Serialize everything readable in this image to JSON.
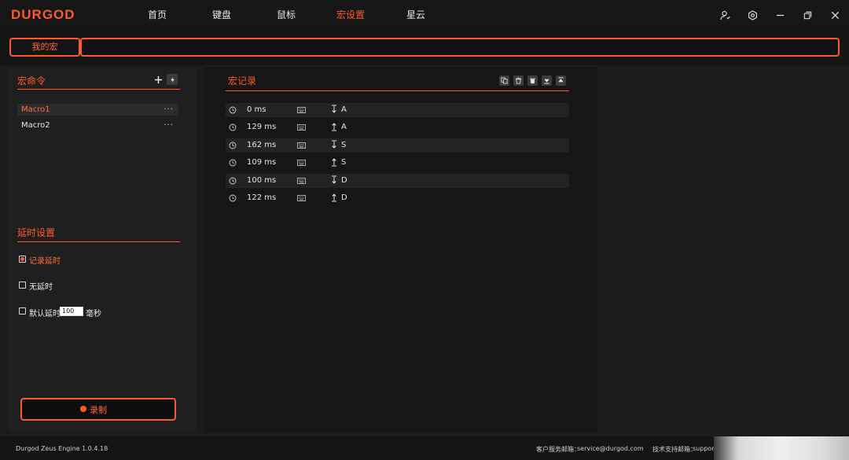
{
  "brand": {
    "logo": "DURGOD",
    "color": "#ff5a2a"
  },
  "nav": [
    {
      "label": "首页",
      "active": false
    },
    {
      "label": "键盘",
      "active": false
    },
    {
      "label": "鼠标",
      "active": false
    },
    {
      "label": "宏设置",
      "active": true
    },
    {
      "label": "星云",
      "active": false
    }
  ],
  "window_icons": [
    "user-icon",
    "settings-gear-icon",
    "minimize-icon",
    "restore-icon",
    "close-icon"
  ],
  "tabbar": {
    "tab_label": "我的宏",
    "name_value": ""
  },
  "macro_panel": {
    "title": "宏命令",
    "add_icon": "plus-icon",
    "import_icon": "bolt-icon",
    "items": [
      {
        "name": "Macro1",
        "selected": true,
        "more": "···"
      },
      {
        "name": "Macro2",
        "selected": false,
        "more": "···"
      }
    ]
  },
  "delay_panel": {
    "title": "延时设置",
    "options": [
      {
        "label": "记录延时",
        "checked": true
      },
      {
        "label": "无延时",
        "checked": false
      },
      {
        "label": "默认延时",
        "checked": false
      }
    ],
    "default_delay_value": "100",
    "unit": "毫秒"
  },
  "record_button": {
    "label": "录制"
  },
  "record_panel": {
    "title": "宏记录",
    "tools": [
      "copy-icon",
      "delete-icon",
      "delete-all-icon",
      "move-down-icon",
      "move-up-icon"
    ],
    "rows": [
      {
        "time": "0 ms",
        "direction": "down",
        "key": "A"
      },
      {
        "time": "129 ms",
        "direction": "up",
        "key": "A"
      },
      {
        "time": "162 ms",
        "direction": "down",
        "key": "S"
      },
      {
        "time": "109 ms",
        "direction": "up",
        "key": "S"
      },
      {
        "time": "100 ms",
        "direction": "down",
        "key": "D"
      },
      {
        "time": "122 ms",
        "direction": "up",
        "key": "D"
      }
    ]
  },
  "footer": {
    "version": "Durgod Zeus Engine 1.0.4.18",
    "service_label": "客户服务邮箱：",
    "service_email": "service@durgod.com",
    "support_label": "技术支持邮箱：",
    "support_email": "support"
  }
}
